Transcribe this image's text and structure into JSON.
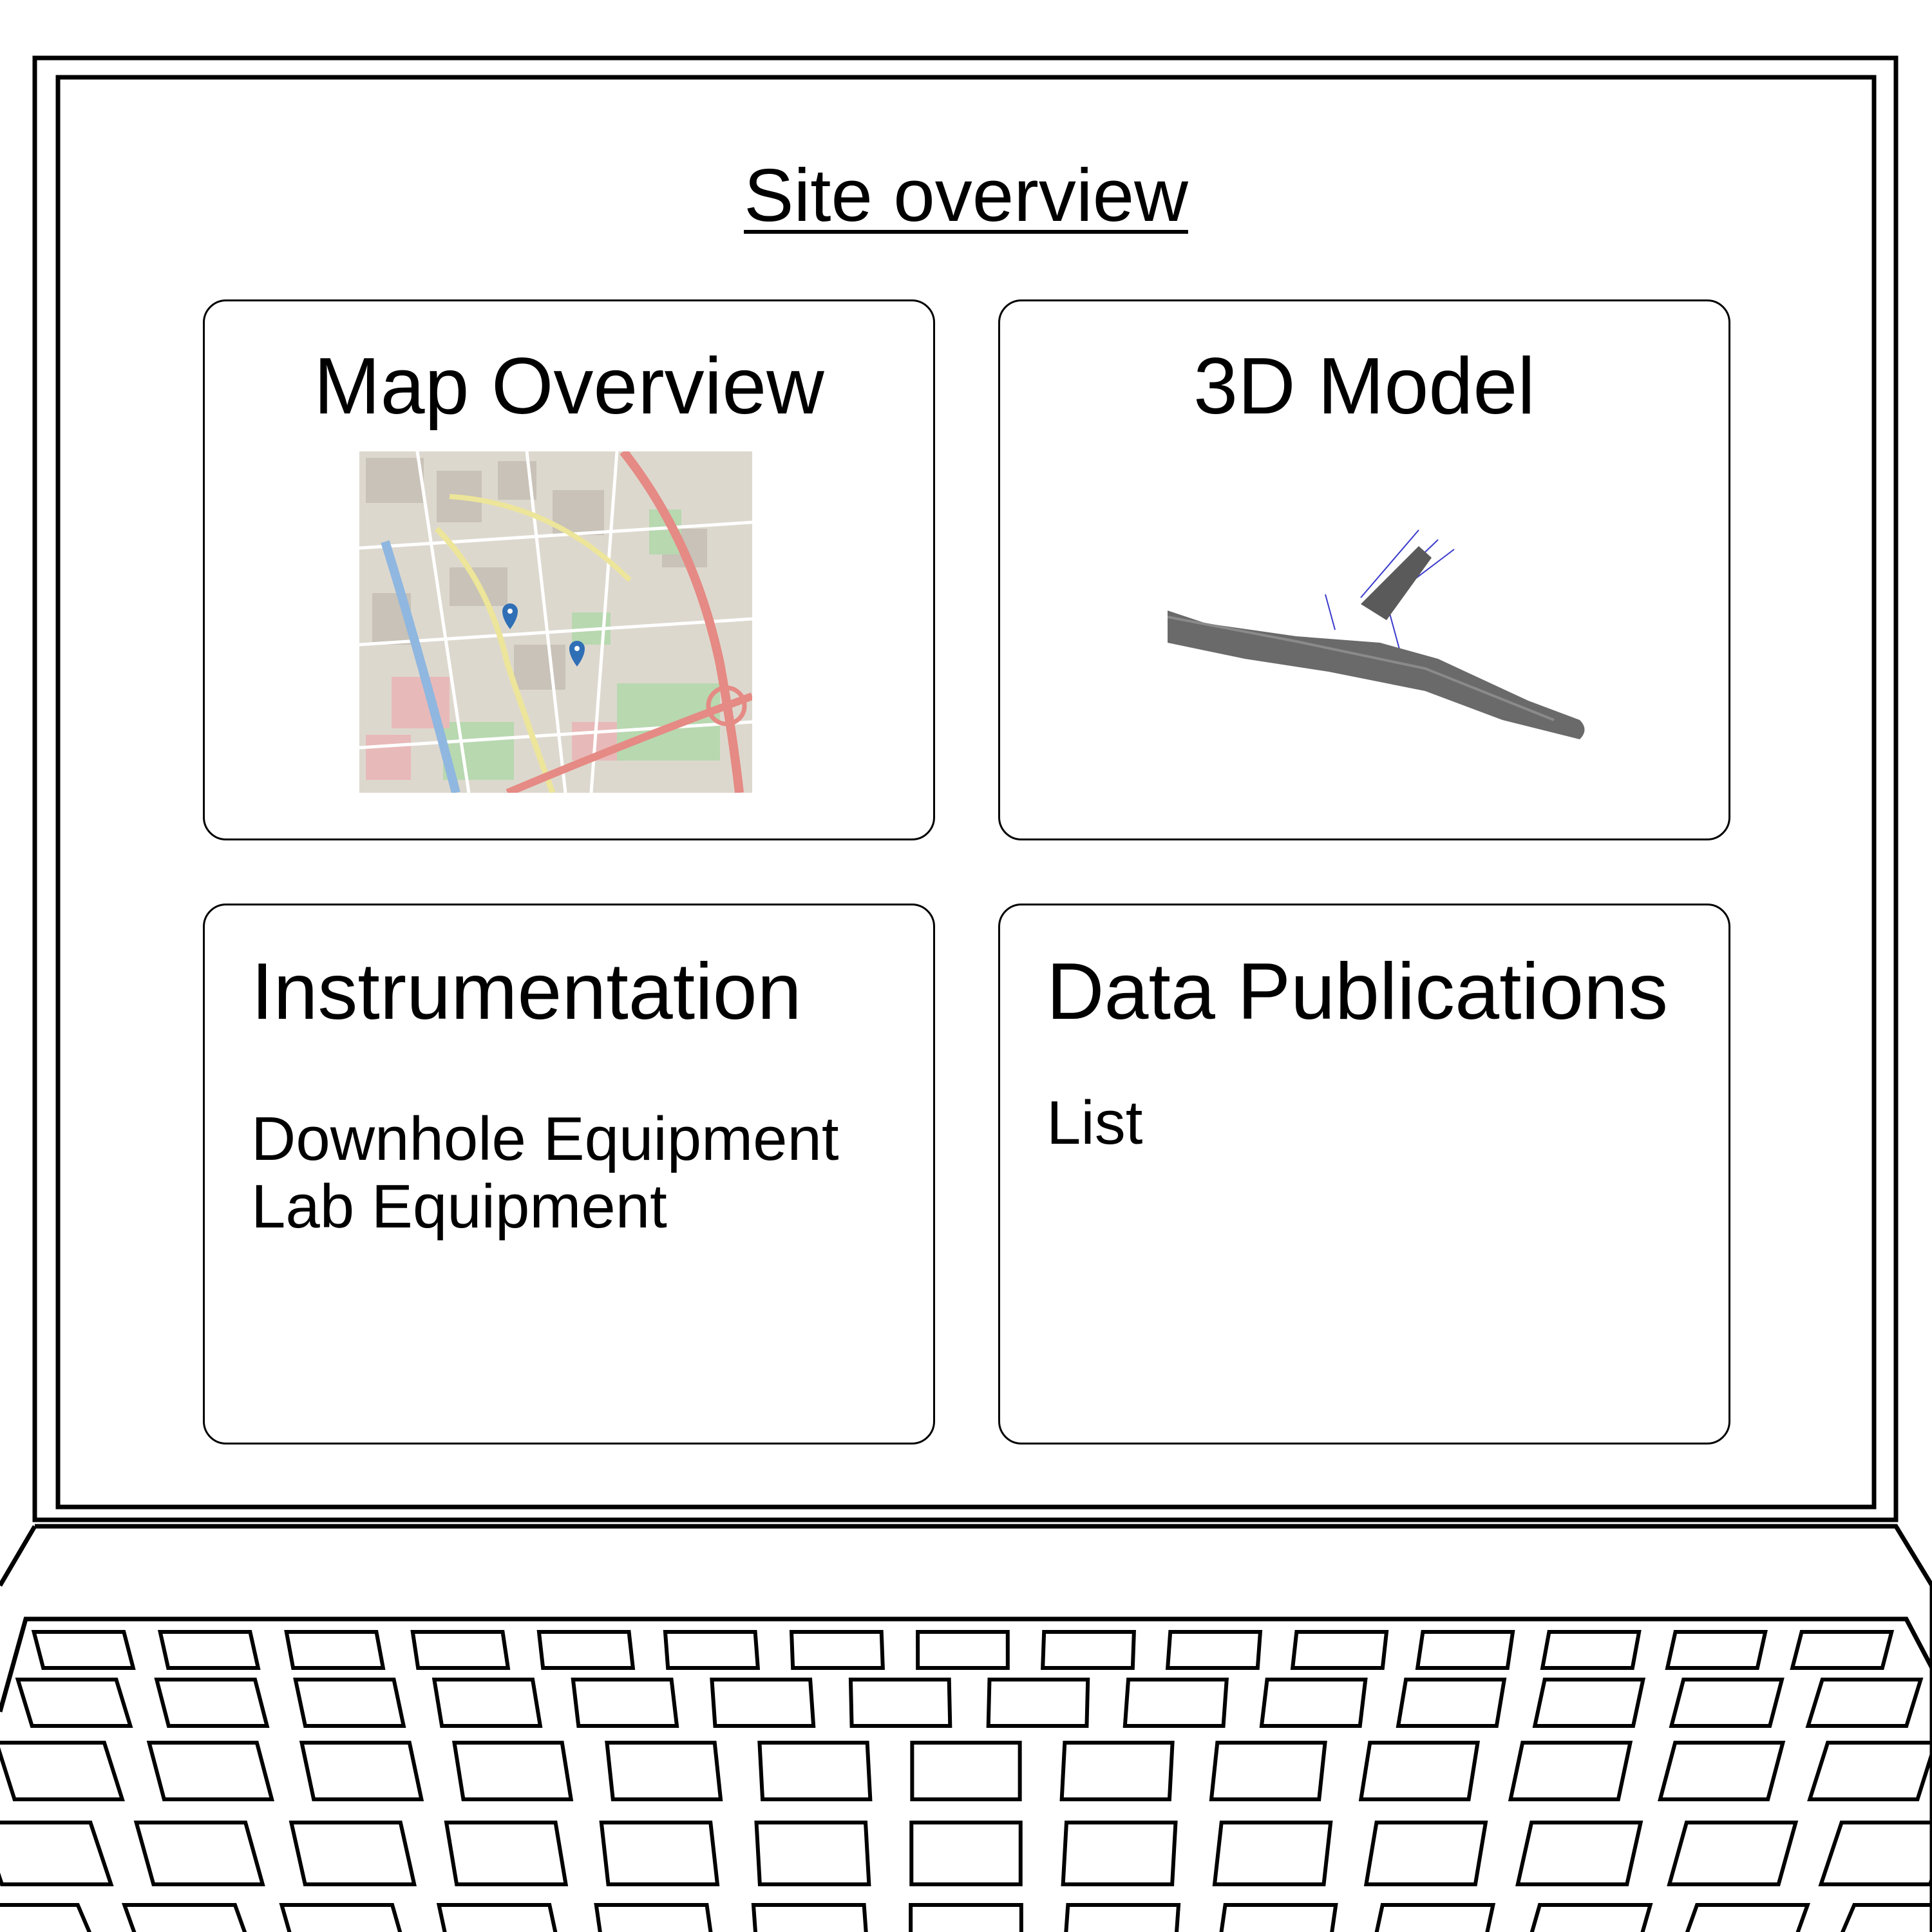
{
  "page": {
    "title": "Site overview"
  },
  "cards": {
    "map": {
      "title": "Map Overview",
      "image_icon": "street-map-icon",
      "marker_color": "#2f6fb5"
    },
    "model": {
      "title": "3D Model",
      "image_icon": "borehole-3d-model-icon",
      "mesh_color": "#606060"
    },
    "instrumentation": {
      "title": "Instrumentation",
      "items": [
        "Downhole Equipment",
        "Lab Equipment"
      ]
    },
    "publications": {
      "title": "Data Publications",
      "items": [
        "List"
      ]
    }
  }
}
